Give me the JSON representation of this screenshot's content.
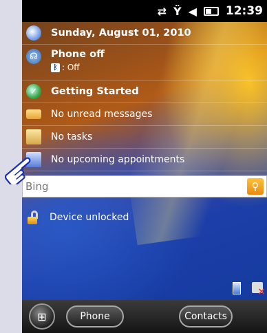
{
  "statusbar": {
    "time": "12:39",
    "icons": [
      "data-arrows-icon",
      "no-signal-icon",
      "speaker-icon",
      "battery-icon"
    ]
  },
  "today": {
    "date": "Sunday, August 01, 2010",
    "phone": {
      "label": "Phone off",
      "bluetooth": ": Off"
    },
    "getting_started": "Getting Started",
    "messages": "No unread messages",
    "tasks": "No tasks",
    "appointments": "No upcoming appointments"
  },
  "search": {
    "placeholder": "Bing"
  },
  "device_status": "Device unlocked",
  "softkeys": {
    "left": "Phone",
    "right": "Contacts"
  },
  "colors": {
    "search_go": "#f0a020",
    "statusbar": "#000000"
  }
}
